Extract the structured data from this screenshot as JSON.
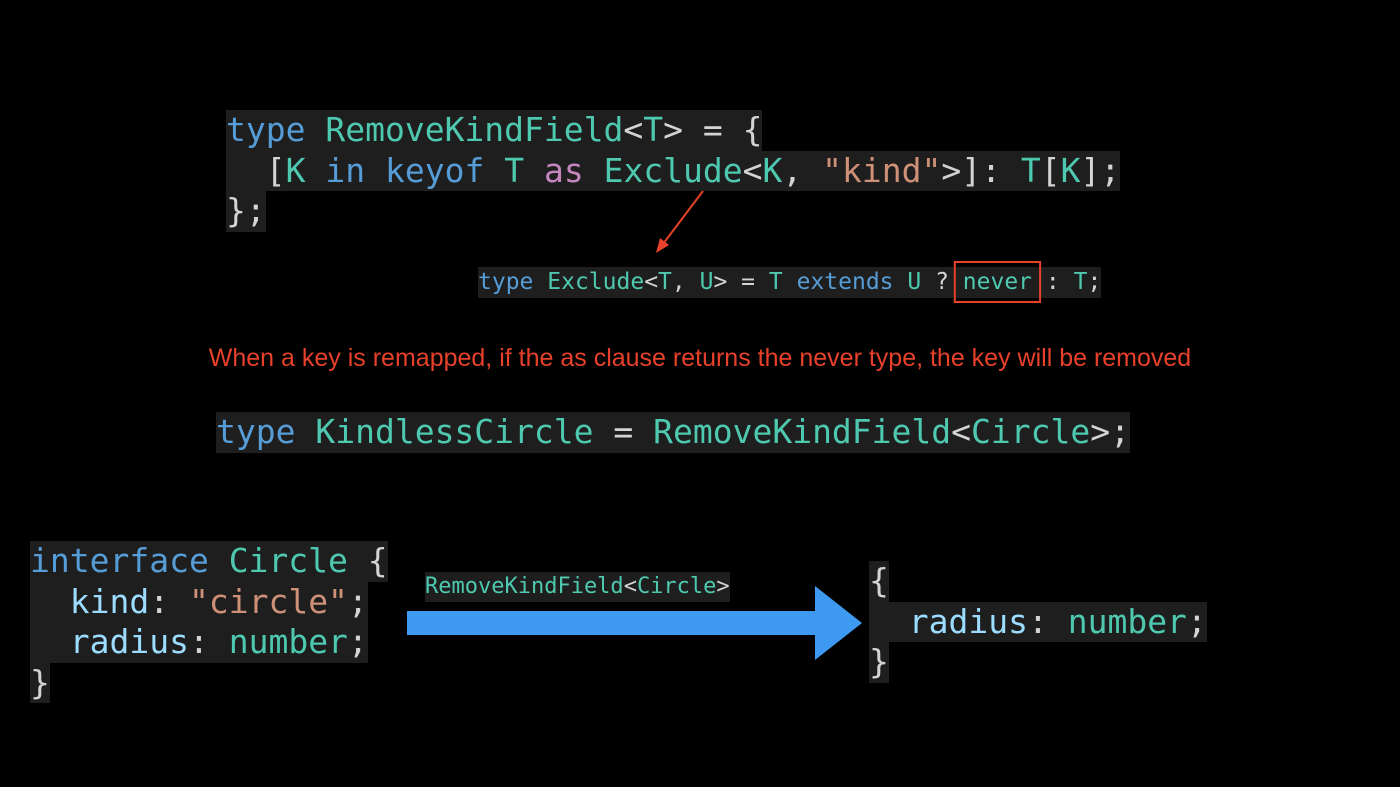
{
  "code_blocks": {
    "remove_kind_field": {
      "lines": [
        [
          {
            "t": "type",
            "c": "kw"
          },
          {
            "t": " ",
            "c": "pl"
          },
          {
            "t": "RemoveKindField",
            "c": "ty"
          },
          {
            "t": "<",
            "c": "pl"
          },
          {
            "t": "T",
            "c": "ty"
          },
          {
            "t": "> = {",
            "c": "pl"
          }
        ],
        [
          {
            "t": "  [",
            "c": "pl"
          },
          {
            "t": "K",
            "c": "ty"
          },
          {
            "t": " ",
            "c": "pl"
          },
          {
            "t": "in",
            "c": "kw"
          },
          {
            "t": " ",
            "c": "pl"
          },
          {
            "t": "keyof",
            "c": "kw"
          },
          {
            "t": " ",
            "c": "pl"
          },
          {
            "t": "T",
            "c": "ty"
          },
          {
            "t": " ",
            "c": "pl"
          },
          {
            "t": "as",
            "c": "kp"
          },
          {
            "t": " ",
            "c": "pl"
          },
          {
            "t": "Exclude",
            "c": "ty"
          },
          {
            "t": "<",
            "c": "pl"
          },
          {
            "t": "K",
            "c": "ty"
          },
          {
            "t": ", ",
            "c": "pl"
          },
          {
            "t": "\"kind\"",
            "c": "st"
          },
          {
            "t": ">]: ",
            "c": "pl"
          },
          {
            "t": "T",
            "c": "ty"
          },
          {
            "t": "[",
            "c": "pl"
          },
          {
            "t": "K",
            "c": "ty"
          },
          {
            "t": "];",
            "c": "pl"
          }
        ],
        [
          {
            "t": "};",
            "c": "pl"
          }
        ]
      ]
    },
    "exclude": {
      "lines": [
        [
          {
            "t": "type",
            "c": "kw"
          },
          {
            "t": " ",
            "c": "pl"
          },
          {
            "t": "Exclude",
            "c": "ty"
          },
          {
            "t": "<",
            "c": "pl"
          },
          {
            "t": "T",
            "c": "ty"
          },
          {
            "t": ", ",
            "c": "pl"
          },
          {
            "t": "U",
            "c": "ty"
          },
          {
            "t": "> = ",
            "c": "pl"
          },
          {
            "t": "T",
            "c": "ty"
          },
          {
            "t": " ",
            "c": "pl"
          },
          {
            "t": "extends",
            "c": "kw"
          },
          {
            "t": " ",
            "c": "pl"
          },
          {
            "t": "U",
            "c": "ty"
          },
          {
            "t": " ? ",
            "c": "pl"
          },
          {
            "t": "never",
            "c": "ty",
            "highlight": true
          },
          {
            "t": " : ",
            "c": "pl"
          },
          {
            "t": "T",
            "c": "ty"
          },
          {
            "t": ";",
            "c": "pl"
          }
        ]
      ]
    },
    "kindless_circle": {
      "lines": [
        [
          {
            "t": "type",
            "c": "kw"
          },
          {
            "t": " ",
            "c": "pl"
          },
          {
            "t": "KindlessCircle",
            "c": "ty"
          },
          {
            "t": " = ",
            "c": "pl"
          },
          {
            "t": "RemoveKindField",
            "c": "ty"
          },
          {
            "t": "<",
            "c": "pl"
          },
          {
            "t": "Circle",
            "c": "ty"
          },
          {
            "t": ">;",
            "c": "pl"
          }
        ]
      ]
    },
    "circle_interface": {
      "lines": [
        [
          {
            "t": "interface",
            "c": "kw"
          },
          {
            "t": " ",
            "c": "pl"
          },
          {
            "t": "Circle",
            "c": "ty"
          },
          {
            "t": " {",
            "c": "pl"
          }
        ],
        [
          {
            "t": "  ",
            "c": "pl"
          },
          {
            "t": "kind",
            "c": "pr"
          },
          {
            "t": ": ",
            "c": "pl"
          },
          {
            "t": "\"circle\"",
            "c": "st"
          },
          {
            "t": ";",
            "c": "pl"
          }
        ],
        [
          {
            "t": "  ",
            "c": "pl"
          },
          {
            "t": "radius",
            "c": "pr"
          },
          {
            "t": ": ",
            "c": "pl"
          },
          {
            "t": "number",
            "c": "ty"
          },
          {
            "t": ";",
            "c": "pl"
          }
        ],
        [
          {
            "t": "}",
            "c": "pl"
          }
        ]
      ]
    },
    "result_type": {
      "lines": [
        [
          {
            "t": "{",
            "c": "pl"
          }
        ],
        [
          {
            "t": "  ",
            "c": "pl"
          },
          {
            "t": "radius",
            "c": "pr"
          },
          {
            "t": ": ",
            "c": "pl"
          },
          {
            "t": "number",
            "c": "ty"
          },
          {
            "t": ";",
            "c": "pl"
          }
        ],
        [
          {
            "t": "}",
            "c": "pl"
          }
        ]
      ]
    }
  },
  "explanation": "When a key is remapped, if the as clause returns the never type, the key will be removed",
  "transform_label": [
    {
      "t": "RemoveKindField",
      "c": "ty"
    },
    {
      "t": "<",
      "c": "pl"
    },
    {
      "t": "Circle",
      "c": "ty"
    },
    {
      "t": ">",
      "c": "pl"
    }
  ],
  "colors": {
    "background": "#000000",
    "code_background": "#1e1e1e",
    "keyword": "#569cd6",
    "type": "#4ec9b0",
    "plain": "#d4d4d4",
    "string": "#ce9178",
    "keyword_purple": "#c586c0",
    "property": "#9cdcfe",
    "annotation_red": "#e8412b",
    "transform_arrow": "#3d9af0"
  },
  "icons": {
    "pointer_arrow": "red-pointer-arrow-icon",
    "transform_arrow": "blue-right-arrow-icon",
    "highlight_box": "red-highlight-box"
  }
}
